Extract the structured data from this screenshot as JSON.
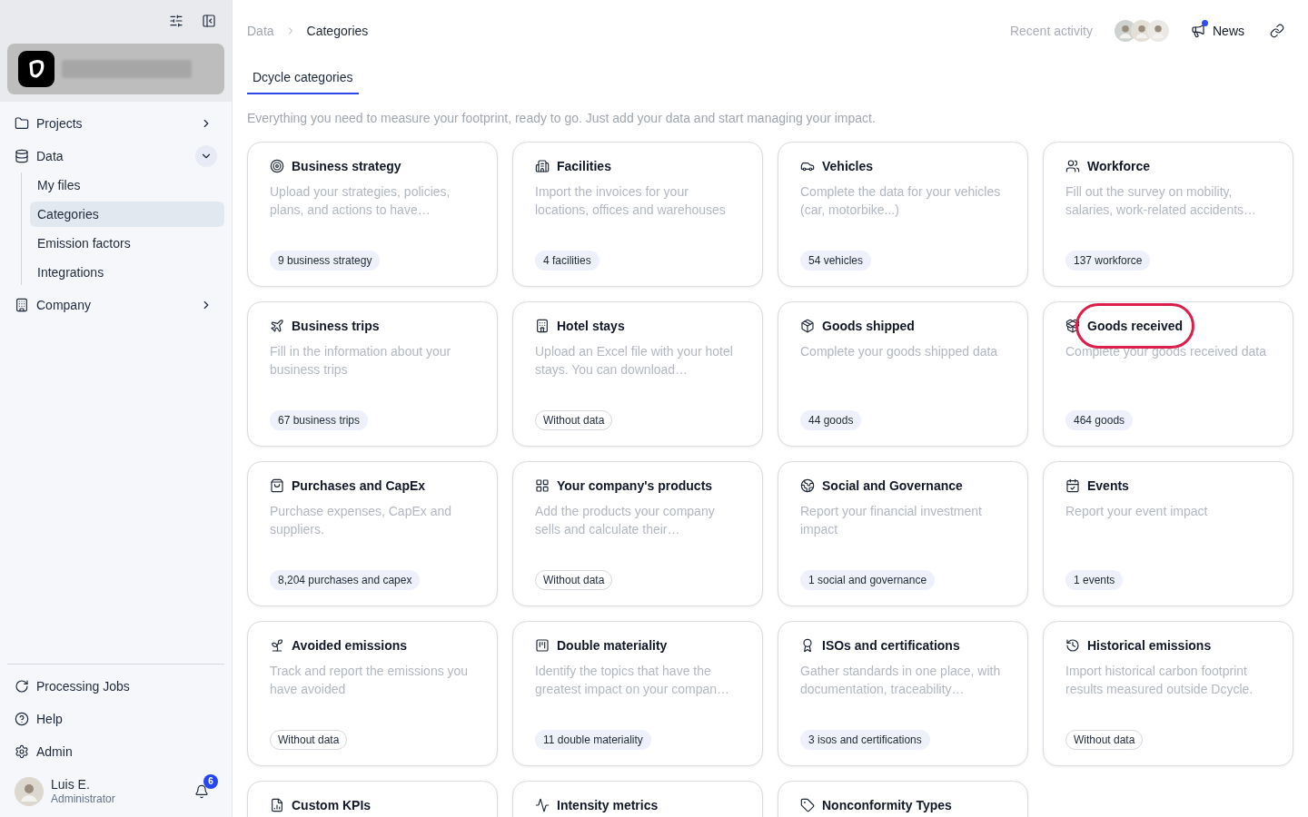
{
  "sidebar": {
    "nav": [
      {
        "label": "Projects",
        "selected": false,
        "expanded": false
      },
      {
        "label": "Data",
        "selected": false,
        "expanded": true,
        "children": [
          {
            "label": "My files",
            "selected": false
          },
          {
            "label": "Categories",
            "selected": true
          },
          {
            "label": "Emission factors",
            "selected": false
          },
          {
            "label": "Integrations",
            "selected": false
          }
        ]
      },
      {
        "label": "Company",
        "selected": false,
        "expanded": false
      }
    ],
    "footer": [
      {
        "label": "Processing Jobs"
      },
      {
        "label": "Help"
      },
      {
        "label": "Admin"
      }
    ],
    "user": {
      "name": "Luis E.",
      "role": "Administrator",
      "notification_count": "6"
    }
  },
  "header": {
    "breadcrumb": [
      {
        "label": "Data"
      },
      {
        "label": "Categories"
      }
    ],
    "recent_activity": "Recent activity",
    "news": {
      "label": "News",
      "unread": true
    }
  },
  "tabs": [
    {
      "label": "Dcycle categories",
      "selected": true
    }
  ],
  "intro": "Everything you need to measure your footprint, ready to go. Just add your data and start managing your impact.",
  "cards": [
    {
      "title": "Business strategy",
      "description": "Upload your strategies, policies, plans, and actions to have…",
      "badge": {
        "text": "9 business strategy",
        "kind": "count"
      },
      "circled": false
    },
    {
      "title": "Facilities",
      "description": "Import the invoices for your locations, offices and warehouses",
      "badge": {
        "text": "4 facilities",
        "kind": "count"
      },
      "circled": false
    },
    {
      "title": "Vehicles",
      "description": "Complete the data for your vehicles (car, motorbike...)",
      "badge": {
        "text": "54 vehicles",
        "kind": "count"
      },
      "circled": false
    },
    {
      "title": "Workforce",
      "description": "Fill out the survey on mobility, salaries, work-related accidents…",
      "badge": {
        "text": "137 workforce",
        "kind": "count"
      },
      "circled": false
    },
    {
      "title": "Business trips",
      "description": "Fill in the information about your business trips",
      "badge": {
        "text": "67 business trips",
        "kind": "count"
      },
      "circled": false
    },
    {
      "title": "Hotel stays",
      "description": "Upload an Excel file with your hotel stays. You can download…",
      "badge": {
        "text": "Without data",
        "kind": "empty"
      },
      "circled": false
    },
    {
      "title": "Goods shipped",
      "description": "Complete your goods shipped data",
      "badge": {
        "text": "44 goods",
        "kind": "count"
      },
      "circled": false
    },
    {
      "title": "Goods received",
      "description": "Complete your goods received data",
      "badge": {
        "text": "464 goods",
        "kind": "count"
      },
      "circled": true
    },
    {
      "title": "Purchases and CapEx",
      "description": "Purchase expenses, CapEx and suppliers.",
      "badge": {
        "text": "8,204 purchases and capex",
        "kind": "count"
      },
      "circled": false
    },
    {
      "title": "Your company's products",
      "description": "Add the products your company sells and calculate their…",
      "badge": {
        "text": "Without data",
        "kind": "empty"
      },
      "circled": false
    },
    {
      "title": "Social and Governance",
      "description": "Report your financial investment impact",
      "badge": {
        "text": "1 social and governance",
        "kind": "count"
      },
      "circled": false
    },
    {
      "title": "Events",
      "description": "Report your event impact",
      "badge": {
        "text": "1 events",
        "kind": "count"
      },
      "circled": false
    },
    {
      "title": "Avoided emissions",
      "description": "Track and report the emissions you have avoided",
      "badge": {
        "text": "Without data",
        "kind": "empty"
      },
      "circled": false
    },
    {
      "title": "Double materiality",
      "description": "Identify the topics that have the greatest impact on your compan…",
      "badge": {
        "text": "11 double materiality",
        "kind": "count"
      },
      "circled": false
    },
    {
      "title": "ISOs and certifications",
      "description": "Gather standards in one place, with documentation, traceability…",
      "badge": {
        "text": "3 isos and certifications",
        "kind": "count"
      },
      "circled": false
    },
    {
      "title": "Historical emissions",
      "description": "Import historical carbon footprint results measured outside Dcycle.",
      "badge": {
        "text": "Without data",
        "kind": "empty"
      },
      "circled": false
    },
    {
      "title": "Custom KPIs",
      "circled": false
    },
    {
      "title": "Intensity metrics",
      "circled": false
    },
    {
      "title": "Nonconformity Types",
      "circled": false
    }
  ]
}
